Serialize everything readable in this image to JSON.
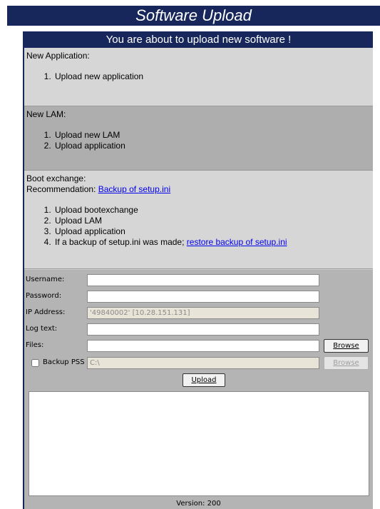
{
  "title": "Software Upload",
  "header": "You are about to upload new software !",
  "sections": {
    "new_application": {
      "heading": "New Application:",
      "steps": [
        "Upload new application"
      ]
    },
    "new_lam": {
      "heading": "New LAM:",
      "steps": [
        "Upload new LAM",
        "Upload application"
      ]
    },
    "boot_exchange": {
      "heading": "Boot exchange:",
      "recommendation_label": "Recommendation: ",
      "recommendation_link": "Backup of setup.ini",
      "steps": [
        "Upload bootexchange",
        "Upload LAM",
        "Upload application"
      ],
      "step4_text": "If a backup of setup.ini was made; ",
      "step4_link": "restore backup of setup.ini"
    }
  },
  "form": {
    "username_label": "Username:",
    "username_value": "",
    "password_label": "Password:",
    "password_value": "",
    "ip_label": "IP Address:",
    "ip_value": "'49840002' [10.28.151.131]",
    "logtext_label": "Log text:",
    "logtext_value": "",
    "files_label": "Files:",
    "files_value": "",
    "browse_label": "Browse",
    "backup_label": "Backup PSS",
    "backup_checked": false,
    "backup_path": "C:\\",
    "browse2_label": "Browse",
    "upload_label": "Upload"
  },
  "version": "Version: 200",
  "colors": {
    "navy": "#17275c",
    "panel_light": "#d6d6d6",
    "panel_dark": "#aeaeae",
    "link": "#0000ee"
  }
}
